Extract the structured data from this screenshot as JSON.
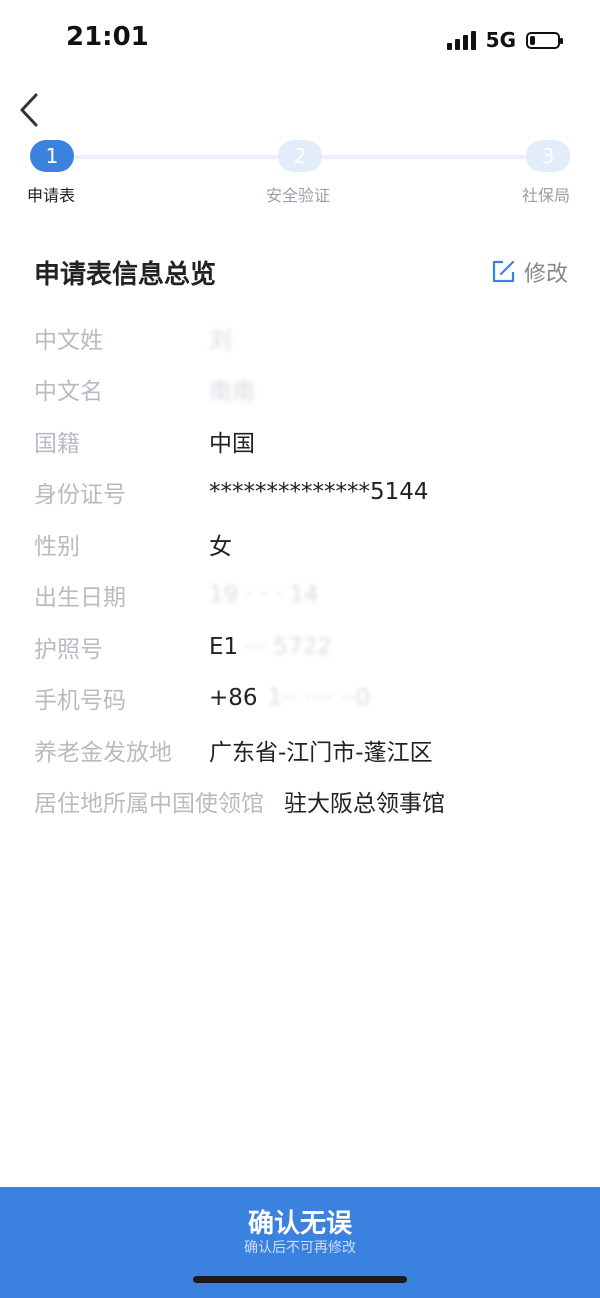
{
  "status_bar": {
    "time": "21:01",
    "network": "5G",
    "battery_level": 0.2
  },
  "nav": {
    "back_icon": "chevron-left-icon"
  },
  "stepper": {
    "steps": [
      {
        "number": "1",
        "label": "申请表",
        "active": true
      },
      {
        "number": "2",
        "label": "安全验证",
        "active": false
      },
      {
        "number": "3",
        "label": "社保局",
        "active": false
      }
    ]
  },
  "section": {
    "title": "申请表信息总览",
    "edit_label": "修改",
    "edit_icon": "edit-icon"
  },
  "info": [
    {
      "label": "中文姓",
      "value": "刘"
    },
    {
      "label": "中文名",
      "value": "南南"
    },
    {
      "label": "国籍",
      "value": "中国"
    },
    {
      "label": "身份证号",
      "value": "**************5144"
    },
    {
      "label": "性别",
      "value": "女"
    },
    {
      "label": "出生日期",
      "value": "19 · · · 14"
    },
    {
      "label": "护照号",
      "value": "E1",
      "value_hidden": "··· 5722"
    },
    {
      "label": "手机号码",
      "value": "+86",
      "value_hidden": "1·· ···· ··0"
    },
    {
      "label": "养老金发放地",
      "value": "广东省-江门市-蓬江区"
    },
    {
      "label": "居住地所属中国使领馆",
      "value": "驻大阪总领事馆"
    }
  ],
  "confirm": {
    "title": "确认无误",
    "subtitle": "确认后不可再修改"
  },
  "colors": {
    "accent": "#3b82e0",
    "label_gray": "#b8bcc2",
    "step_inactive": "#e2ecfa"
  }
}
